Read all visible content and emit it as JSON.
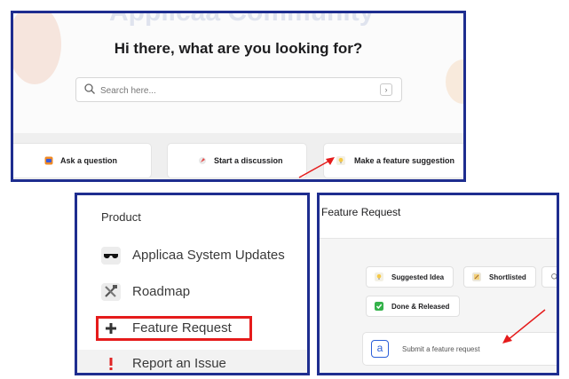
{
  "top": {
    "bg_title": "Applicaa Community",
    "greeting": "Hi there, what are you looking for?",
    "search_placeholder": "Search here...",
    "search_go": "›",
    "tiles": [
      {
        "label": "Ask a question",
        "icon": "chat-bubble-icon"
      },
      {
        "label": "Start a discussion",
        "icon": "rocket-icon"
      },
      {
        "label": "Make a feature suggestion",
        "icon": "lightbulb-icon"
      }
    ]
  },
  "nav_panel": {
    "section": "Product",
    "items": [
      {
        "label": "Applicaa System Updates",
        "icon": "sunglasses-icon"
      },
      {
        "label": "Roadmap",
        "icon": "tools-icon"
      },
      {
        "label": "Feature Request",
        "icon": "plus-icon"
      },
      {
        "label": "Report an Issue",
        "icon": "exclamation-icon"
      }
    ]
  },
  "feature_panel": {
    "title": "Feature Request",
    "chips": [
      {
        "label": "Suggested Idea",
        "icon": "lightbulb-icon"
      },
      {
        "label": "Shortlisted",
        "icon": "memo-icon"
      },
      {
        "label": "",
        "icon": "search-icon"
      },
      {
        "label": "Done & Released",
        "icon": "check-icon"
      }
    ],
    "submit_placeholder": "Submit a feature request",
    "submit_avatar": "a"
  },
  "colors": {
    "frame": "#1e2d8f",
    "highlight": "#e51b1b",
    "annotation_arrow": "#e51b1b"
  }
}
